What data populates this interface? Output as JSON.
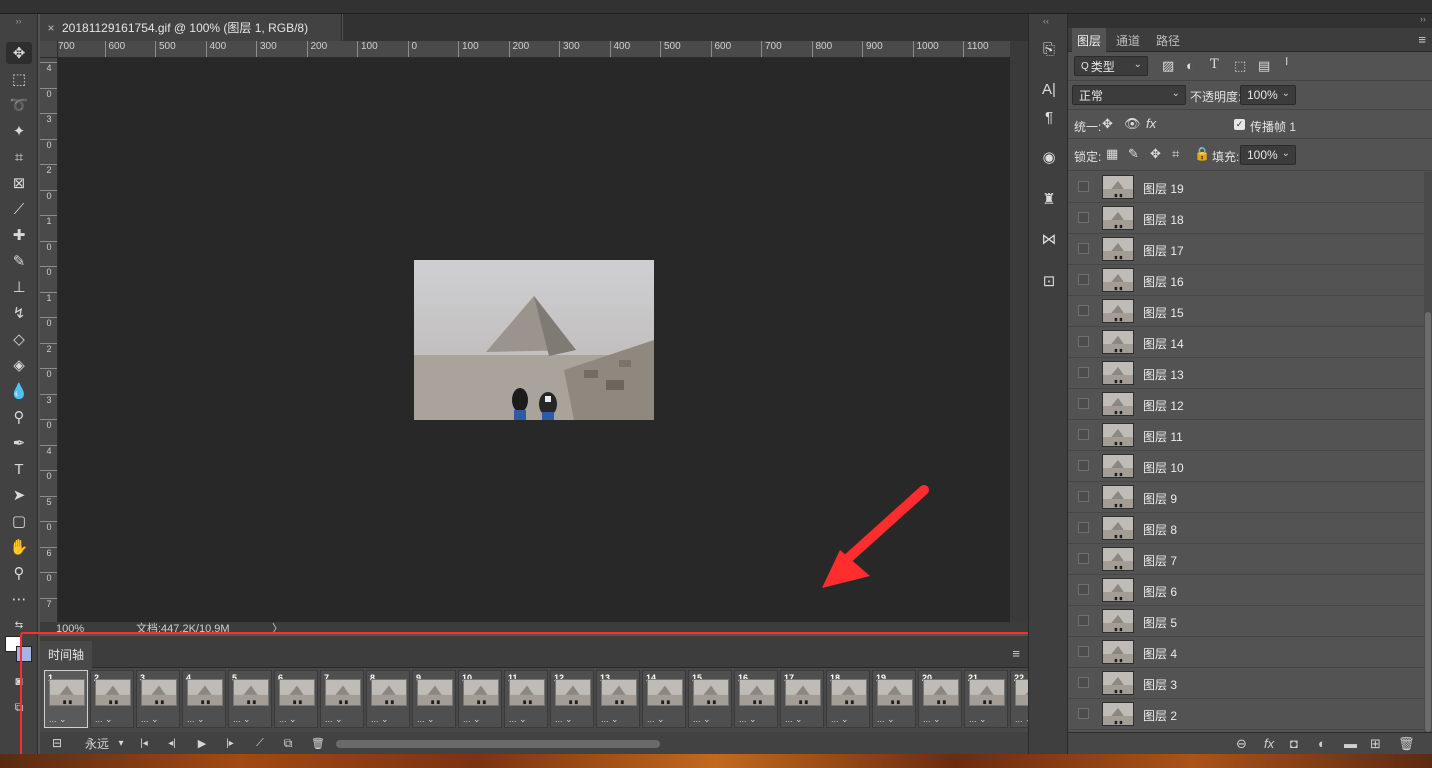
{
  "document": {
    "tab_title": "20181129161754.gif @ 100% (图层 1, RGB/8)",
    "close_glyph": "×"
  },
  "ruler": {
    "h_labels": [
      "700",
      "600",
      "500",
      "400",
      "300",
      "200",
      "100",
      "0",
      "100",
      "200",
      "300",
      "400",
      "500",
      "600",
      "700",
      "800",
      "900",
      "1000",
      "1100"
    ],
    "v_labels": [
      "4",
      "0",
      "3",
      "0",
      "2",
      "0",
      "1",
      "0",
      "0",
      "1",
      "0",
      "2",
      "0",
      "3",
      "0",
      "4",
      "0",
      "5",
      "0",
      "6",
      "0",
      "7"
    ]
  },
  "status": {
    "zoom": "100%",
    "doc_info": "文档:447.2K/10.9M",
    "arrow": "〉"
  },
  "timeline": {
    "tab_label": "时间轴",
    "menu_glyph": "≡",
    "frames": [
      {
        "num": "1",
        "delay": "... ⌄"
      },
      {
        "num": "2",
        "delay": "... ⌄"
      },
      {
        "num": "3",
        "delay": "... ⌄"
      },
      {
        "num": "4",
        "delay": "... ⌄"
      },
      {
        "num": "5",
        "delay": "... ⌄"
      },
      {
        "num": "6",
        "delay": "... ⌄"
      },
      {
        "num": "7",
        "delay": "... ⌄"
      },
      {
        "num": "8",
        "delay": "... ⌄"
      },
      {
        "num": "9",
        "delay": "... ⌄"
      },
      {
        "num": "10",
        "delay": "... ⌄"
      },
      {
        "num": "11",
        "delay": "... ⌄"
      },
      {
        "num": "12",
        "delay": "... ⌄"
      },
      {
        "num": "13",
        "delay": "... ⌄"
      },
      {
        "num": "14",
        "delay": "... ⌄"
      },
      {
        "num": "15",
        "delay": "... ⌄"
      },
      {
        "num": "16",
        "delay": "... ⌄"
      },
      {
        "num": "17",
        "delay": "... ⌄"
      },
      {
        "num": "18",
        "delay": "... ⌄"
      },
      {
        "num": "19",
        "delay": "... ⌄"
      },
      {
        "num": "20",
        "delay": "... ⌄"
      },
      {
        "num": "21",
        "delay": "... ⌄"
      },
      {
        "num": "22",
        "delay": "... ⌄"
      }
    ],
    "loop_label": "永远",
    "loop_arrow": "▾",
    "glyphs": {
      "convert": "⊟",
      "first": "|◂",
      "prev": "◂|",
      "play": "▶",
      "next": "|▸",
      "tween": "⟋",
      "duplicate": "⧉",
      "delete": "🗑"
    }
  },
  "layers_panel": {
    "tabs": [
      "图层",
      "通道",
      "路径"
    ],
    "menu_glyph": "≡",
    "filter": {
      "label": "类型",
      "prefix": "Q"
    },
    "blend_mode": "正常",
    "opacity_label": "不透明度:",
    "opacity_value": "100%",
    "unify_label": "统一:",
    "propagate_label": "传播帧 1",
    "lock_label": "锁定:",
    "fill_label": "填充:",
    "fill_value": "100%",
    "layers": [
      "图层 19",
      "图层 18",
      "图层 17",
      "图层 16",
      "图层 15",
      "图层 14",
      "图层 13",
      "图层 12",
      "图层 11",
      "图层 10",
      "图层 9",
      "图层 8",
      "图层 7",
      "图层 6",
      "图层 5",
      "图层 4",
      "图层 3",
      "图层 2"
    ],
    "bottom_icons": {
      "link": "⊖",
      "fx": "fx",
      "mask": "◘",
      "adjust": "◐",
      "folder": "▬",
      "new": "⊞",
      "trash": "🗑"
    }
  },
  "colors": {
    "annotation": "#ff2d2d",
    "canvas_bg": "#282828",
    "panel_bg": "#535353"
  }
}
